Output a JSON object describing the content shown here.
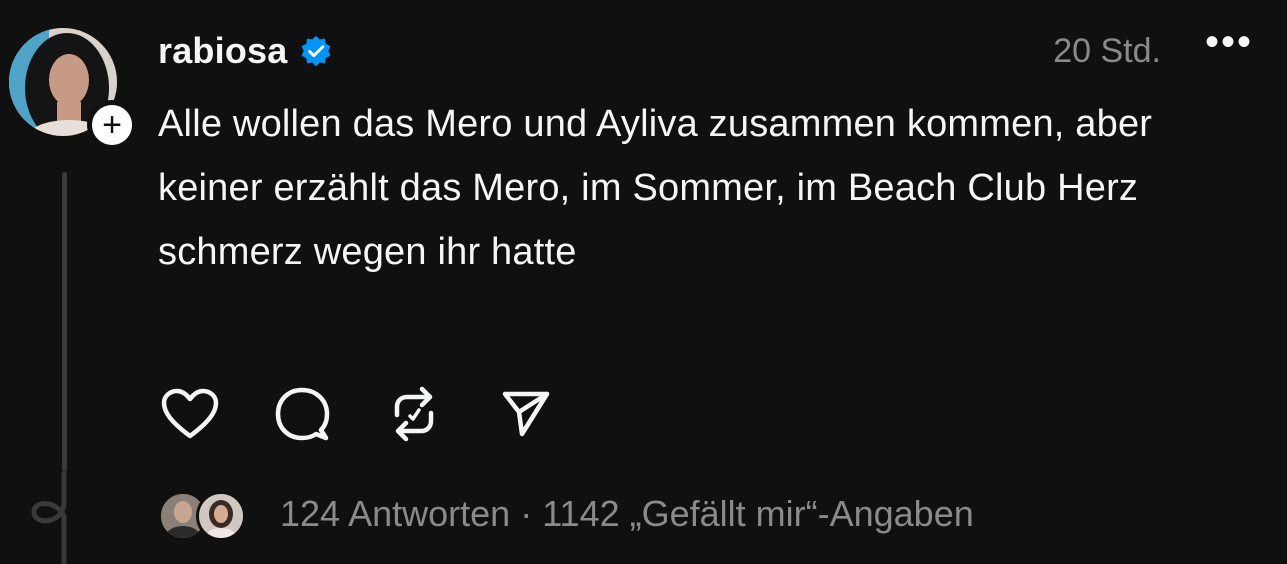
{
  "post": {
    "username": "rabiosa",
    "verified": true,
    "time": "20 Std.",
    "more_label": "•••",
    "follow_label": "+",
    "text": "Alle wollen das Mero und Ayliva zusammen kommen, aber keiner erzählt das Mero, im Sommer, im Beach Club Herz schmerz wegen ihr hatte",
    "actions": [
      {
        "name": "like",
        "icon": "heart-icon"
      },
      {
        "name": "reply",
        "icon": "comment-icon"
      },
      {
        "name": "repost",
        "icon": "repost-icon"
      },
      {
        "name": "share",
        "icon": "send-icon"
      }
    ],
    "replies": "124 Antworten",
    "separator": "·",
    "likes": "1142 „Gefällt mir“-Angaben"
  },
  "colors": {
    "background": "#101010",
    "text": "#f3f5f7",
    "muted": "#8a8a8a",
    "verified": "#0095f6",
    "thread_line": "#3a3a3a"
  }
}
